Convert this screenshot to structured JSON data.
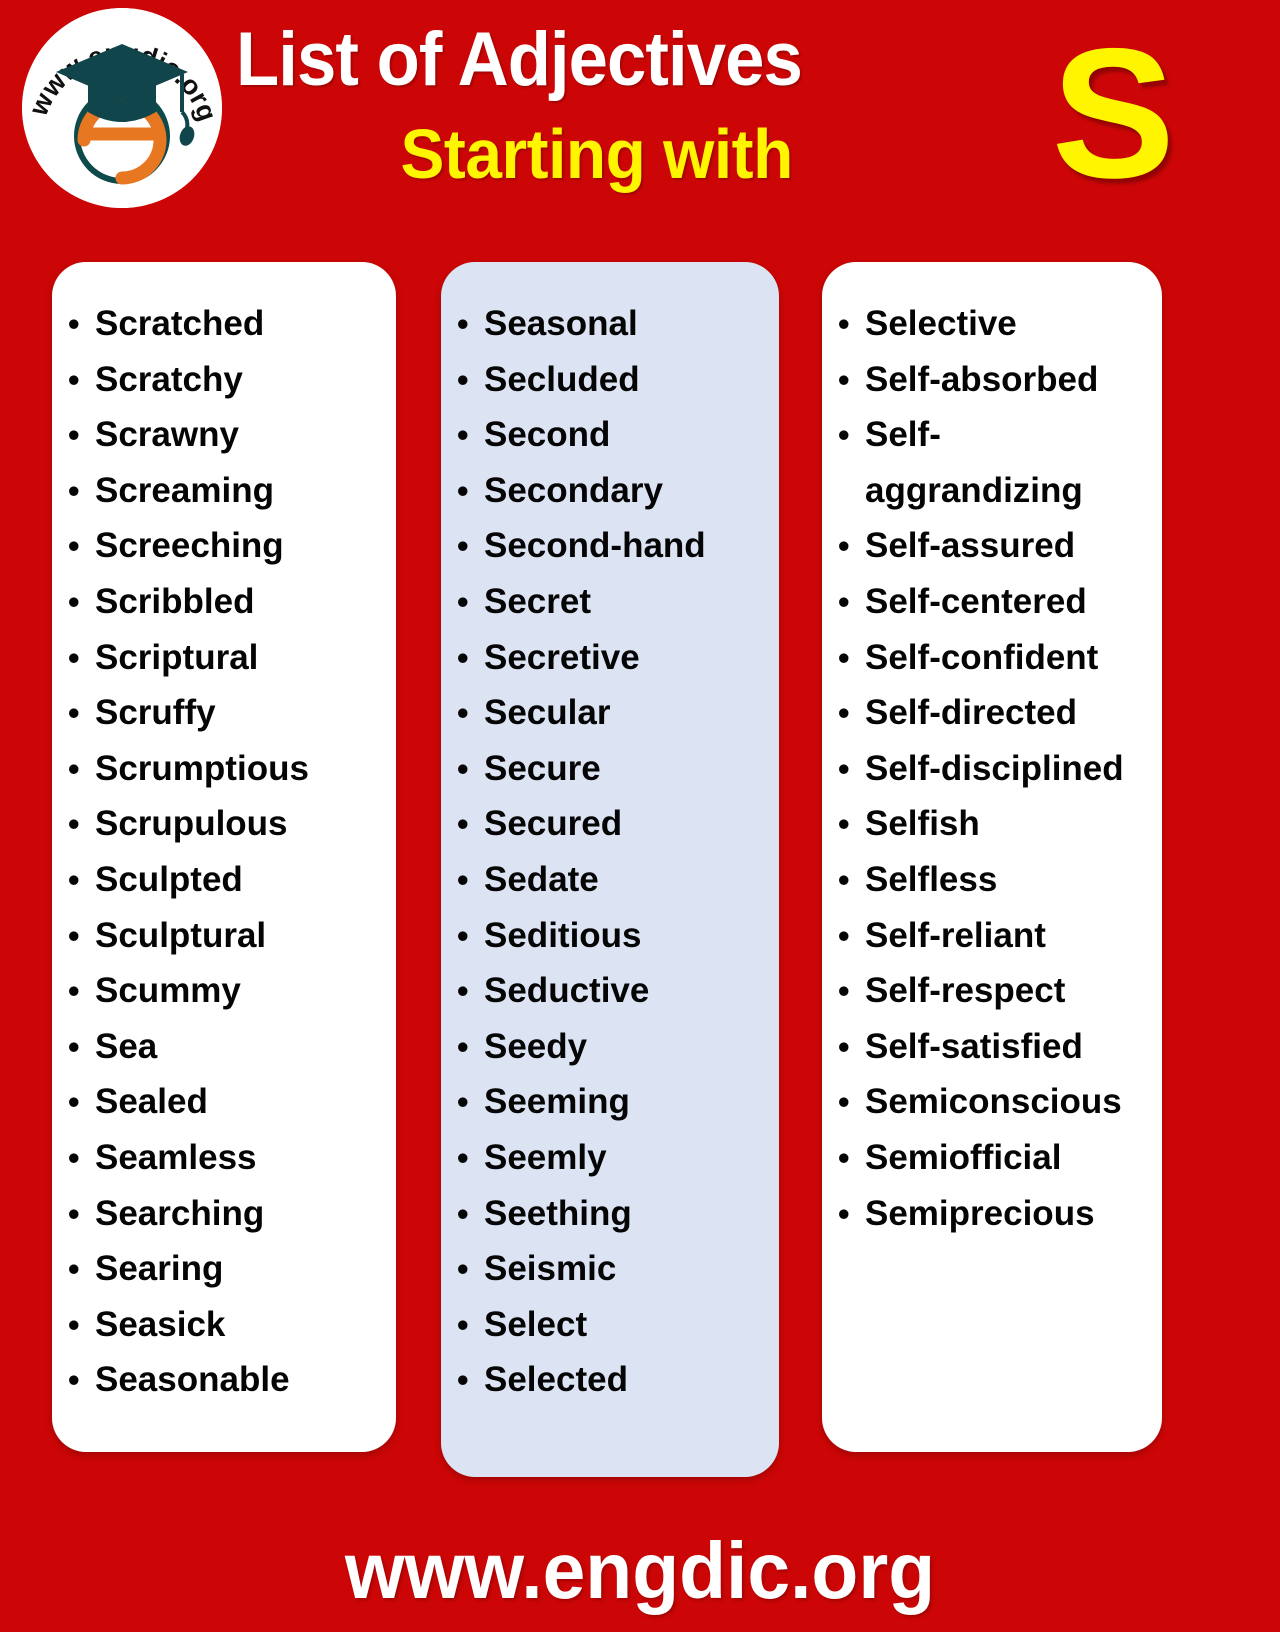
{
  "brand": {
    "logo_text": "www.engdic.org",
    "logo_icon": "graduation-cap-e-monogram"
  },
  "header": {
    "title_line1": "List of Adjectives",
    "title_line2": "Starting with",
    "big_letter": "S",
    "colors": {
      "background_red": "#CC0606",
      "title_white": "#FFFFFF",
      "accent_yellow": "#FFF500",
      "panel_white": "#FFFFFF",
      "panel_blue": "#DCE3F3",
      "text_black": "#050505"
    }
  },
  "columns": [
    {
      "id": "column-1",
      "background": "#FFFFFF",
      "words": [
        "Scratched",
        "Scratchy",
        "Scrawny",
        "Screaming",
        "Screeching",
        "Scribbled",
        "Scriptural",
        "Scruffy",
        "Scrumptious",
        "Scrupulous",
        "Sculpted",
        "Sculptural",
        "Scummy",
        "Sea",
        "Sealed",
        "Seamless",
        "Searching",
        "Searing",
        "Seasick",
        "Seasonable"
      ]
    },
    {
      "id": "column-2",
      "background": "#DCE3F3",
      "words": [
        "Seasonal",
        "Secluded",
        "Second",
        "Secondary",
        "Second-hand",
        "Secret",
        "Secretive",
        "Secular",
        "Secure",
        "Secured",
        "Sedate",
        "Seditious",
        "Seductive",
        "Seedy",
        "Seeming",
        "Seemly",
        "Seething",
        "Seismic",
        "Select",
        "Selected"
      ]
    },
    {
      "id": "column-3",
      "background": "#FFFFFF",
      "words": [
        "Selective",
        "Self-absorbed",
        "Self-aggrandizing",
        "Self-assured",
        "Self-centered",
        "Self-confident",
        "Self-directed",
        "Self-disciplined",
        "Selfish",
        "Selfless",
        "Self-reliant",
        "Self-respect",
        "Self-satisfied",
        "Semiconscious",
        "Semiofficial",
        "Semiprecious"
      ]
    }
  ],
  "bullet_glyph": "•",
  "footer": {
    "website": "www.engdic.org"
  }
}
